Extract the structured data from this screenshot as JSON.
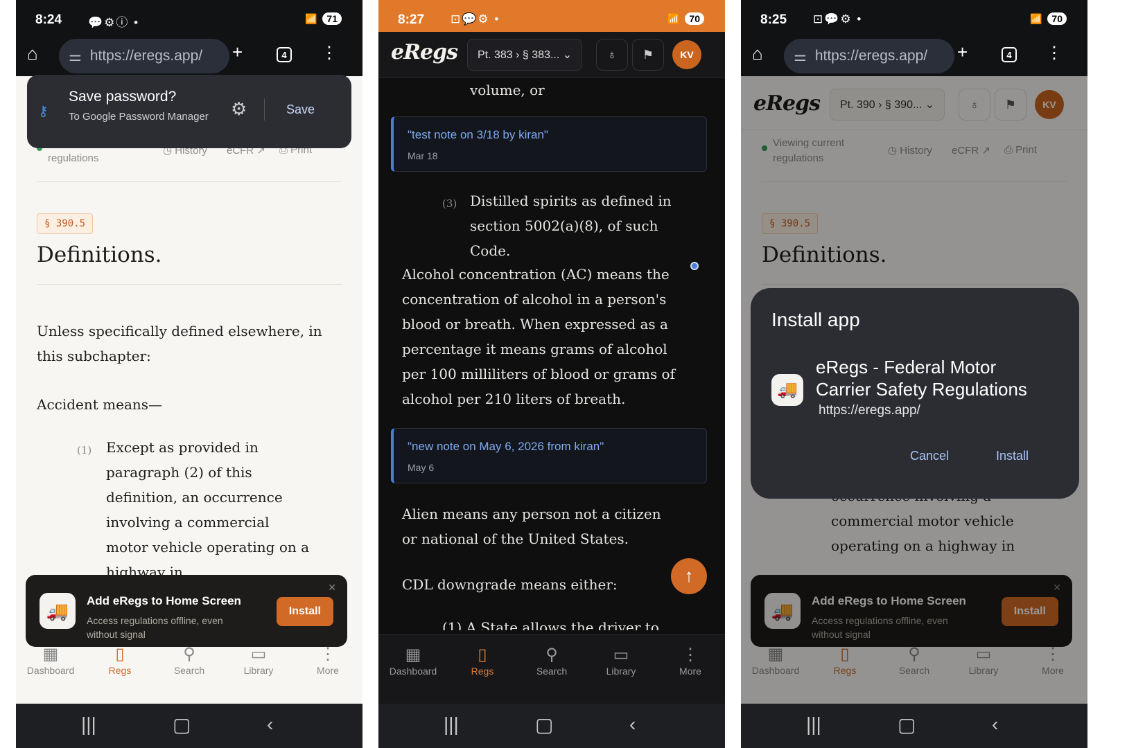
{
  "status": {
    "p1_time": "8:24",
    "p1_battery": "71",
    "p2_time": "8:27",
    "p2_battery": "70",
    "p3_time": "8:25",
    "p3_battery": "70"
  },
  "browser": {
    "url": "https://eregs.app/",
    "tab_count": "4"
  },
  "save_password": {
    "title": "Save password?",
    "subtitle": "To Google Password Manager",
    "save_label": "Save"
  },
  "header": {
    "logo": "eRegs",
    "p2_crumb": "Pt. 383 › § 383...",
    "p3_crumb": "Pt. 390 › § 390...",
    "avatar": "KV"
  },
  "subbar": {
    "viewing": "Viewing current regulations",
    "history": "History",
    "ecfr": "eCFR",
    "print": "Print"
  },
  "section": {
    "tag": "§ 390.5",
    "title": "Definitions.",
    "intro": "Unless specifically defined elsewhere, in this subchapter:",
    "accident": "Accident means—",
    "item1_num": "(1)",
    "item1_text": "Except as provided in paragraph (2) of this definition, an occurrence involving a commercial motor vehicle operating on a highway in"
  },
  "dark": {
    "volume": "volume, or",
    "note1_text": "\"test note on 3/18 by kiran\"",
    "note1_date": "Mar 18",
    "item3_num": "(3)",
    "item3_text": "Distilled spirits as defined in section 5002(a)(8), of such Code.",
    "alcohol": "Alcohol concentration (AC) means the concentration of alcohol in a person's blood or breath. When expressed as a percentage it means grams of alcohol per 100 milliliters of blood or grams of alcohol per 210 liters of breath.",
    "note2_text": "\"new note on May 6, 2026 from kiran\"",
    "note2_date": "May 6",
    "alien": "Alien means any person not a citizen or national of the United States.",
    "cdl": "CDL downgrade means either:",
    "partial": "(1)    A State allows the driver to"
  },
  "toast": {
    "title": "Add eRegs to Home Screen",
    "desc": "Access regulations offline, even without signal",
    "install": "Install"
  },
  "install_dialog": {
    "title": "Install app",
    "app_name": "eRegs - Federal Motor Carrier Safety Regulations",
    "url": "https://eregs.app/",
    "cancel": "Cancel",
    "install": "Install"
  },
  "p3_bg_text": "occurrence involving a commercial motor vehicle operating on a highway in",
  "nav": {
    "dashboard": "Dashboard",
    "regs": "Regs",
    "search": "Search",
    "library": "Library",
    "more": "More"
  },
  "colors": {
    "accent": "#d06a26",
    "note_border": "#4b7fd6",
    "status_orange": "#e07a2a"
  }
}
